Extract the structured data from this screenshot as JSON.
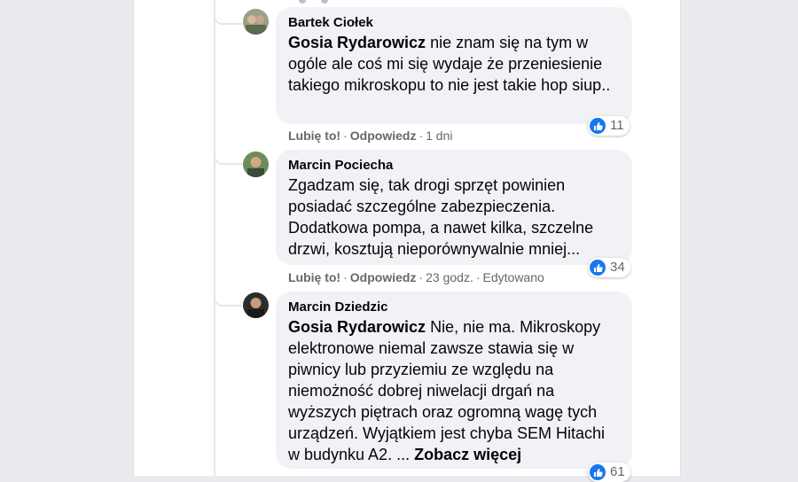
{
  "comments": [
    {
      "author": "Bartek Ciołek",
      "mention": "Gosia Rydarowicz",
      "text": " nie znam się na tym w ogóle ale coś mi się wydaje że przeniesienie takiego mikroskopu to nie jest takie hop siup..",
      "like_label": "Lubię to!",
      "reply_label": "Odpowiedz",
      "time": "1 dni",
      "reaction_count": "11"
    },
    {
      "author": "Marcin Pociecha",
      "text": "Zgadzam się, tak drogi sprzęt powinien posiadać szczególne zabezpieczenia. Dodatkowa pompa, a nawet kilka, szczelne drzwi, kosztują nieporównywalnie mniej...",
      "like_label": "Lubię to!",
      "reply_label": "Odpowiedz",
      "time": "23 godz.",
      "edited": "Edytowano",
      "reaction_count": "34"
    },
    {
      "author": "Marcin Dziedzic",
      "mention": "Gosia Rydarowicz",
      "text": " Nie, nie ma. Mikroskopy elektronowe niemal zawsze stawia się w piwnicy lub przyziemiu ze względu na niemożność dobrej niwelacji drgań na wyższych piętrach oraz ogromną wagę tych urządzeń. Wyjątkiem jest chyba SEM Hitachi w budynku A2. ... ",
      "see_more": "Zobacz więcej",
      "reaction_count": "61"
    }
  ],
  "colors": {
    "bubble": "#f0f2f5",
    "like_blue": "#1877f2",
    "meta_gray": "#65676b"
  },
  "icons": [
    "avatar",
    "like-icon"
  ]
}
